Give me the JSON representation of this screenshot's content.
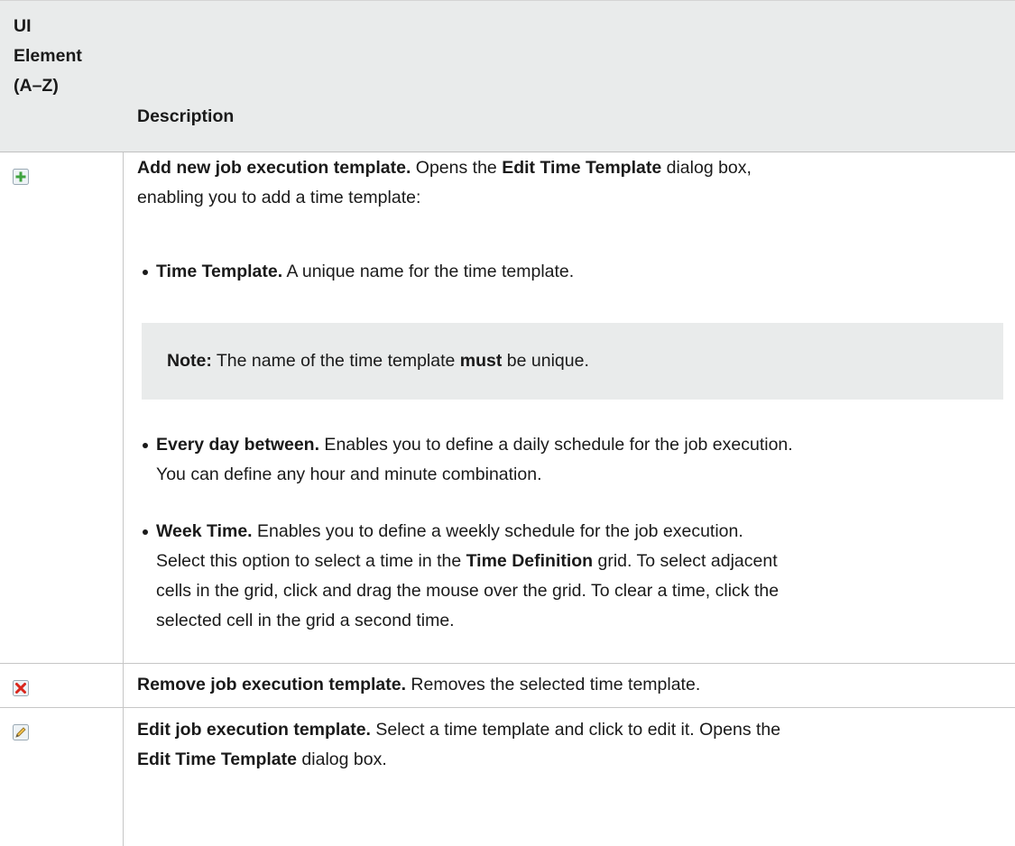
{
  "header": {
    "col1_line1": "UI",
    "col1_line2": "Element",
    "col1_line3": "(A–Z)",
    "col2": "Description"
  },
  "rows": {
    "add": {
      "icon": "add-plus-icon",
      "title": "Add new job execution template.",
      "text1": " Opens the ",
      "bold1": "Edit Time Template",
      "text2": " dialog box,",
      "line2": "enabling you to add a time template:",
      "bullets": {
        "b1": {
          "title": "Time Template.",
          "text": " A unique name for the time template."
        },
        "b2": {
          "title": "Every day between.",
          "text_line1": " Enables you to define a daily schedule for the job execution.",
          "line2": "You can define any hour and minute combination."
        },
        "b3": {
          "title": "Week Time.",
          "text_line1": " Enables you to define a weekly schedule for the job execution.",
          "l2a": "Select this option to select a time in the ",
          "l2b": "Time Definition",
          "l2c": " grid. To select adjacent",
          "line3": "cells in the grid, click and drag the mouse over the grid. To clear a time, click the",
          "line4": "selected cell in the grid a second time."
        }
      },
      "note": {
        "label": "Note:",
        "t1": " The name of the time template ",
        "bold": "must",
        "t2": " be unique."
      }
    },
    "remove": {
      "icon": "remove-x-icon",
      "title": "Remove job execution template.",
      "text": " Removes the selected time template."
    },
    "edit": {
      "icon": "edit-pencil-icon",
      "title": "Edit job execution template.",
      "text1": " Select a time template and click to edit it. Opens the",
      "bold2": "Edit Time Template",
      "text2": " dialog box."
    }
  },
  "colors": {
    "header_bg": "#e9ebeb",
    "note_bg": "#e9ebeb",
    "add_icon": "#3fa33f",
    "remove_icon": "#d9261c"
  }
}
